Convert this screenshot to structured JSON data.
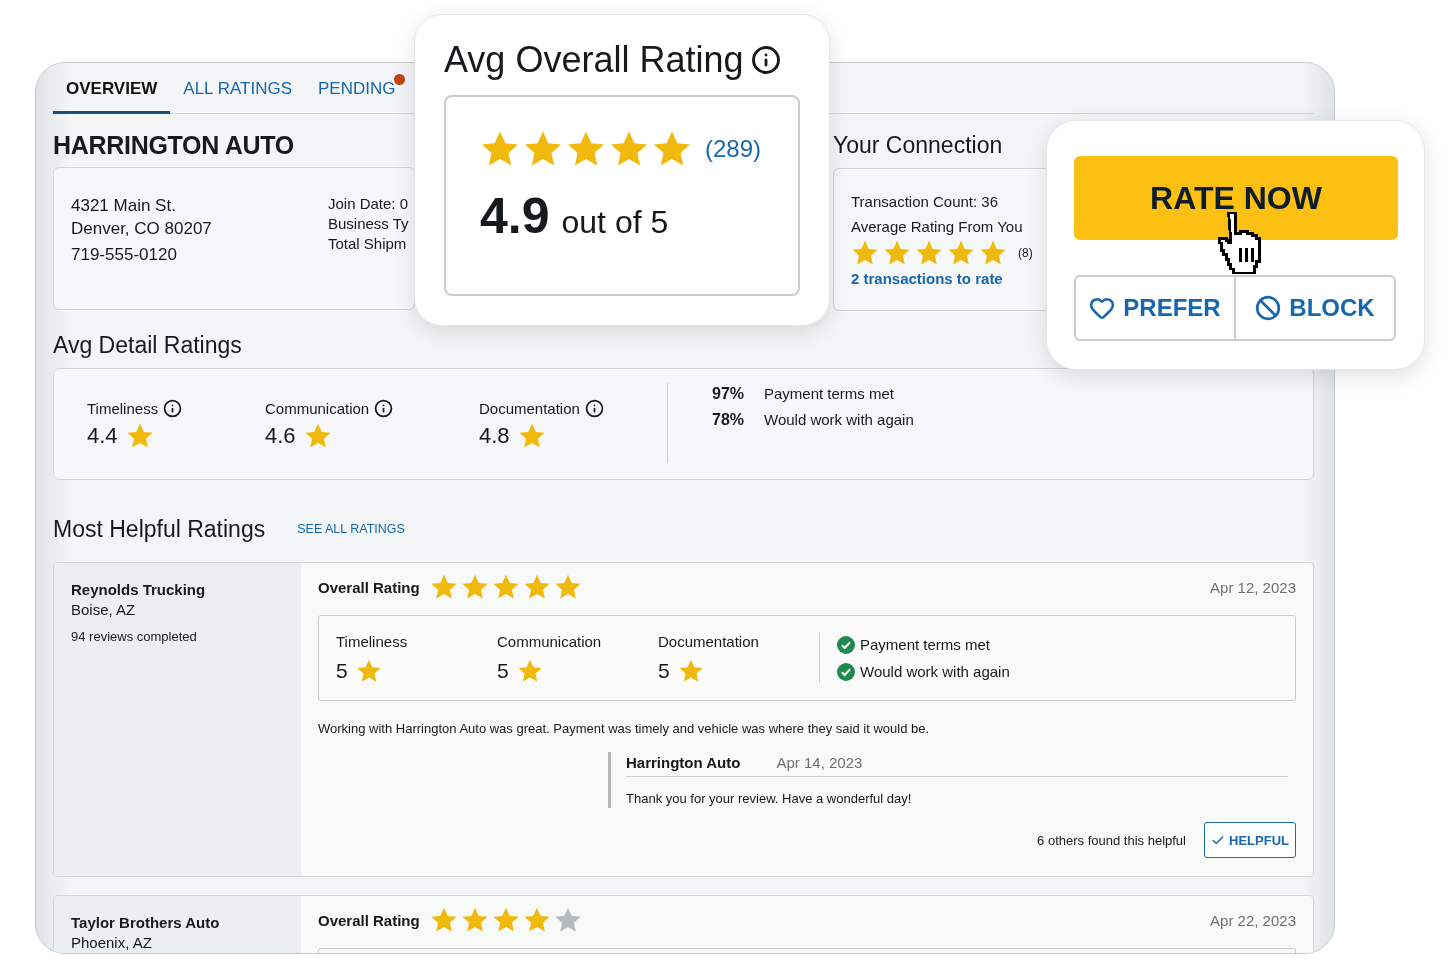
{
  "tabs": [
    {
      "label": "OVERVIEW",
      "selected": true,
      "notification": false
    },
    {
      "label": "ALL RATINGS",
      "selected": false,
      "notification": false
    },
    {
      "label": "PENDING",
      "selected": false,
      "notification": true
    }
  ],
  "business": {
    "name": "HARRINGTON AUTO",
    "address_lines": [
      "4321 Main St.",
      "Denver, CO 80207"
    ],
    "phone": "719-555-0120",
    "details": [
      "Join Date: 0",
      "Business Ty",
      "Total Shipm"
    ]
  },
  "overall_rating": {
    "title": "Avg Overall Rating",
    "stars": 5,
    "count": "(289)",
    "score": "4.9",
    "out_of": "out of 5"
  },
  "connection": {
    "title": "Your Connection",
    "transaction_count": "Transaction Count: 36",
    "average_label": "Average Rating From You",
    "stars": 5,
    "count": "(8)",
    "link": "2 transactions to rate"
  },
  "actions": {
    "rate_now": "RATE NOW",
    "prefer": "PREFER",
    "block": "BLOCK"
  },
  "detail_ratings": {
    "title": "Avg Detail Ratings",
    "items": [
      {
        "label": "Timeliness",
        "value": "4.4"
      },
      {
        "label": "Communication",
        "value": "4.6"
      },
      {
        "label": "Documentation",
        "value": "4.8"
      }
    ],
    "stats": [
      {
        "percent": "97%",
        "label": "Payment terms met"
      },
      {
        "percent": "78%",
        "label": "Would work with again"
      }
    ]
  },
  "helpful": {
    "title": "Most Helpful Ratings",
    "link": "SEE ALL RATINGS",
    "reviews": [
      {
        "reviewer": "Reynolds Trucking",
        "location": "Boise, AZ",
        "reviews_completed": "94 reviews completed",
        "overall_label": "Overall Rating",
        "stars": 5,
        "date": "Apr 12, 2023",
        "details": [
          {
            "label": "Timeliness",
            "value": "5"
          },
          {
            "label": "Communication",
            "value": "5"
          },
          {
            "label": "Documentation",
            "value": "5"
          }
        ],
        "checks": [
          {
            "label": "Payment terms met",
            "checked": true
          },
          {
            "label": "Would work with again",
            "checked": true
          }
        ],
        "comment": "Working with Harrington Auto was great. Payment was timely and vehicle was where they said it would be.",
        "reply": {
          "author": "Harrington Auto",
          "date": "Apr 14, 2023",
          "text": "Thank you for your review. Have a wonderful day!"
        },
        "helpful_count": "6 others found this helpful",
        "helpful_button": "HELPFUL"
      },
      {
        "reviewer": "Taylor Brothers Auto",
        "location": "Phoenix, AZ",
        "overall_label": "Overall Rating",
        "stars": 4,
        "date": "Apr 22, 2023"
      }
    ]
  }
}
